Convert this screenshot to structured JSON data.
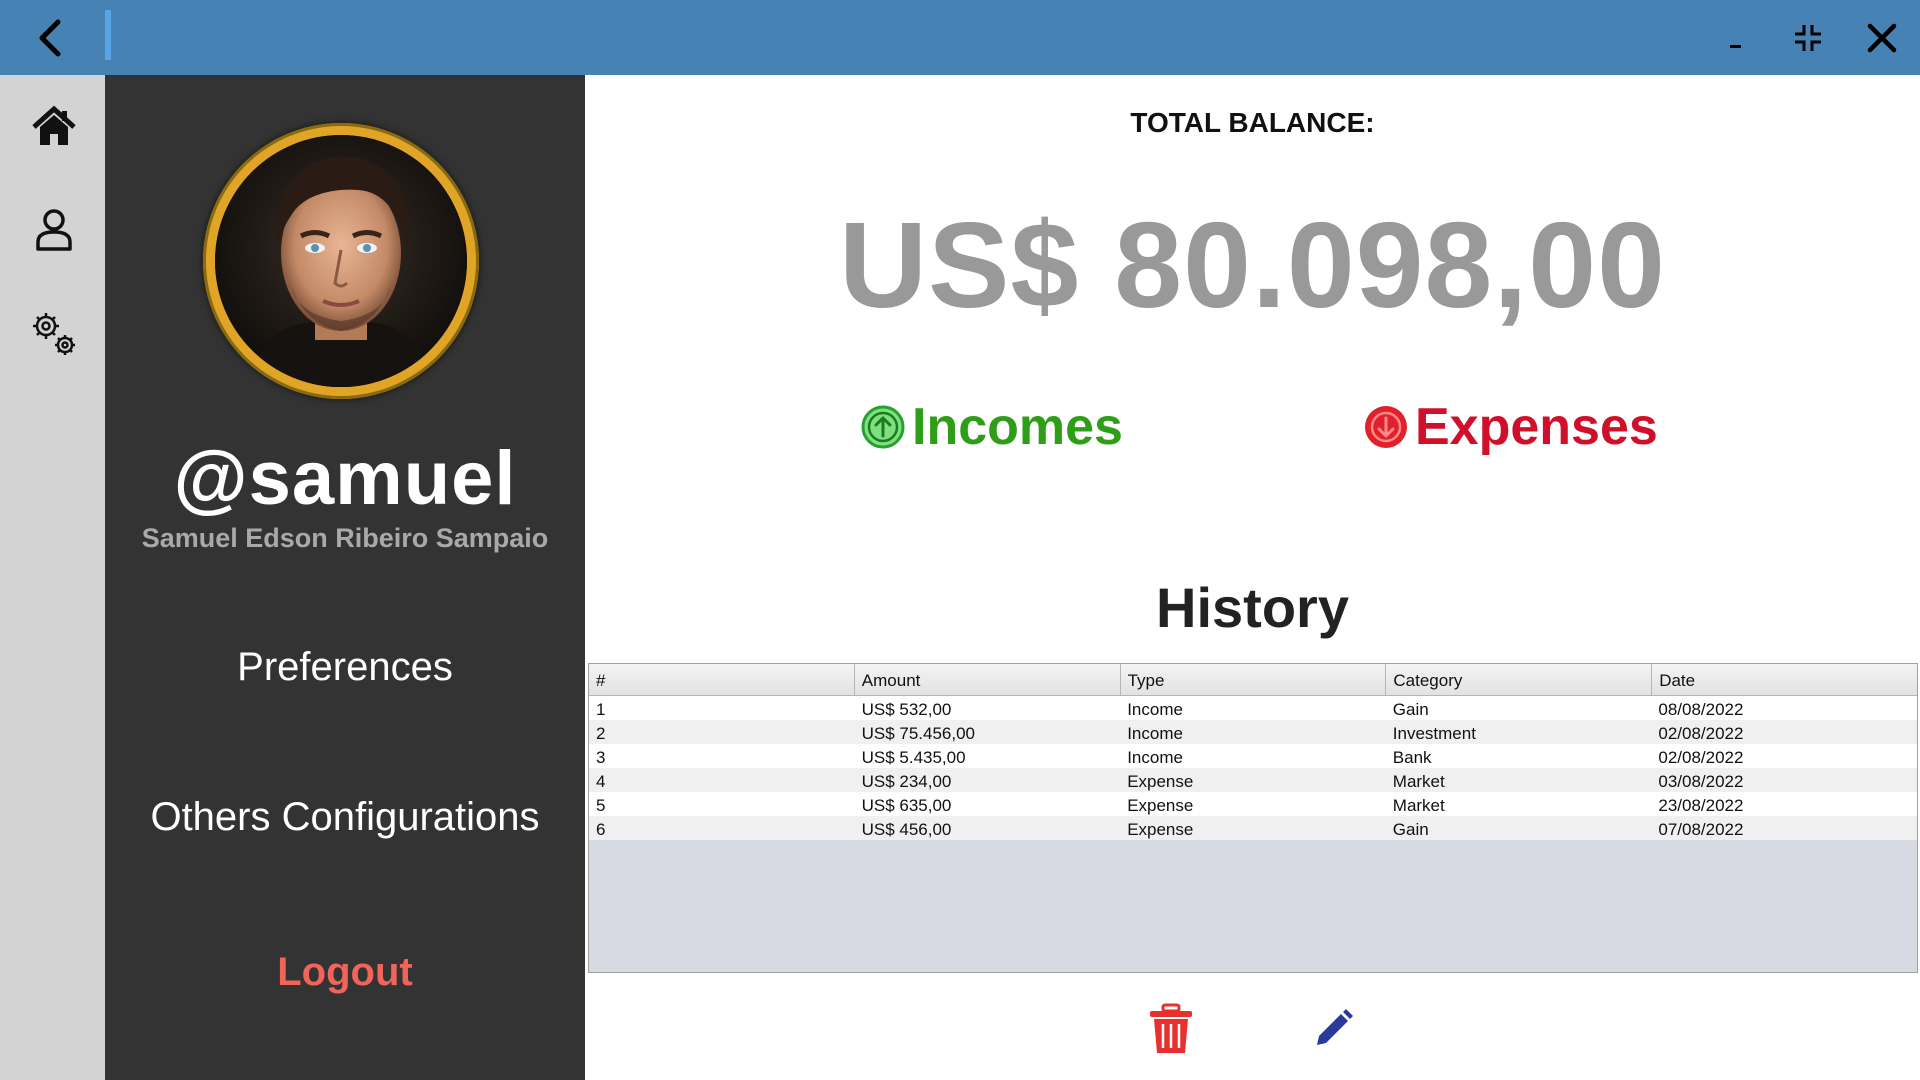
{
  "window": {
    "back_icon": "chevron-left-icon",
    "minimize_icon": "minimize-icon",
    "restore_icon": "restore-icon",
    "close_icon": "close-icon",
    "colors": {
      "titlebar": "#4682b4",
      "accent": "#5aa5e6"
    }
  },
  "rail": {
    "items": [
      {
        "icon": "home-icon"
      },
      {
        "icon": "user-icon"
      },
      {
        "icon": "settings-icon"
      }
    ]
  },
  "profile": {
    "username": "@samuel",
    "full_name": "Samuel Edson Ribeiro Sampaio",
    "menu": [
      {
        "label": "Preferences"
      },
      {
        "label": "Others Configurations"
      }
    ],
    "logout_label": "Logout"
  },
  "balance": {
    "label": "TOTAL BALANCE:",
    "value": "US$ 80.098,00"
  },
  "flows": {
    "incomes_label": "Incomes",
    "expenses_label": "Expenses",
    "incomes_color": "#2e9e18",
    "expenses_color": "#d0102a"
  },
  "history": {
    "title": "History",
    "columns": [
      "#",
      "Amount",
      "Type",
      "Category",
      "Date"
    ],
    "rows": [
      [
        "1",
        "US$ 532,00",
        "Income",
        "Gain",
        "08/08/2022"
      ],
      [
        "2",
        "US$ 75.456,00",
        "Income",
        "Investment",
        "02/08/2022"
      ],
      [
        "3",
        "US$ 5.435,00",
        "Income",
        "Bank",
        "02/08/2022"
      ],
      [
        "4",
        "US$ 234,00",
        "Expense",
        "Market",
        "03/08/2022"
      ],
      [
        "5",
        "US$ 635,00",
        "Expense",
        "Market",
        "23/08/2022"
      ],
      [
        "6",
        "US$ 456,00",
        "Expense",
        "Gain",
        "07/08/2022"
      ]
    ]
  },
  "actions": {
    "delete_icon": "trash-icon",
    "edit_icon": "pencil-icon"
  }
}
